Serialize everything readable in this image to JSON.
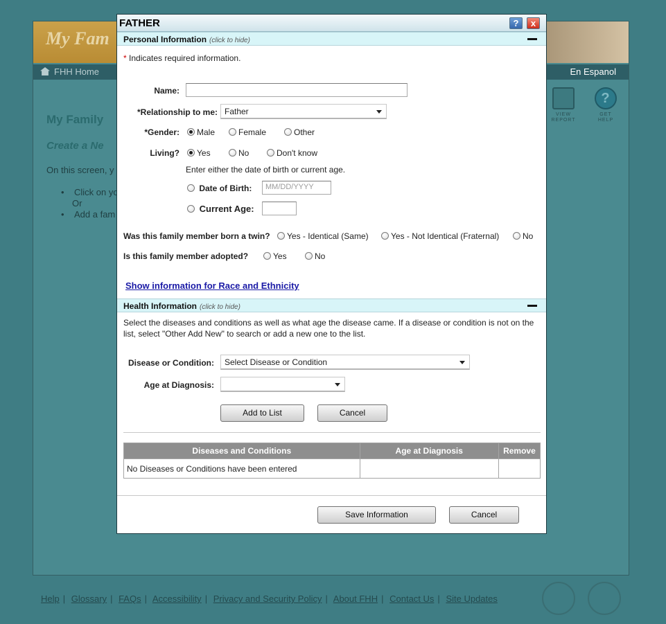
{
  "background": {
    "banner_title": "My Fam",
    "nav_home": "FHH Home",
    "nav_espanol": "En Espanol",
    "heading": "My Family",
    "subheading": "Create a Ne",
    "body_text": "On this screen, y",
    "bullet1": "Click on yo",
    "bullet_or": "Or",
    "bullet2": "Add a fam",
    "tool_report": "VIEW\nREPORT",
    "tool_help": "GET\nHELP",
    "footer_links": [
      "Help",
      "Glossary",
      "FAQs",
      "Accessibility",
      "Privacy and Security Policy",
      "About FHH",
      "Contact Us",
      "Site Updates"
    ]
  },
  "dialog": {
    "title": "FATHER",
    "help_glyph": "?",
    "close_glyph": "x",
    "personal": {
      "section_title": "Personal Information",
      "section_hint": "(click to hide)",
      "required_note_star": "*",
      "required_note": " Indicates required information.",
      "name_label": "Name:",
      "name_value": "",
      "relationship_label": "*Relationship to me:",
      "relationship_value": "Father",
      "gender_label": "*Gender:",
      "gender_options": [
        "Male",
        "Female",
        "Other"
      ],
      "gender_selected": "Male",
      "living_label": "Living?",
      "living_options": [
        "Yes",
        "No",
        "Don't know"
      ],
      "living_selected": "Yes",
      "age_instruction": "Enter either the date of birth or current age.",
      "dob_label": "Date of Birth:",
      "dob_placeholder": "MM/DD/YYYY",
      "current_age_label": "Current Age:",
      "current_age_value": "",
      "twin_question": "Was this family member born  a twin?",
      "twin_options": [
        "Yes - Identical (Same)",
        "Yes - Not Identical (Fraternal)",
        "No"
      ],
      "adopted_question": "Is this family member adopted?",
      "adopted_options": [
        "Yes",
        "No"
      ],
      "race_link": "Show information for Race and Ethnicity"
    },
    "health": {
      "section_title": "Health Information",
      "section_hint": "(click to hide)",
      "instructions": "Select the diseases and conditions as well as what age the disease came. If a disease or condition is not on the list, select \"Other Add New\" to search or add a new one to the list.",
      "disease_label": "Disease or Condition:",
      "disease_value": "Select Disease or Condition",
      "age_label": "Age at Diagnosis:",
      "age_value": "",
      "add_button": "Add to List",
      "cancel_button": "Cancel",
      "table_headers": [
        "Diseases and Conditions",
        "Age at Diagnosis",
        "Remove"
      ],
      "empty_message": "No Diseases or Conditions have been entered"
    },
    "save_button": "Save Information",
    "cancel_button": "Cancel"
  }
}
